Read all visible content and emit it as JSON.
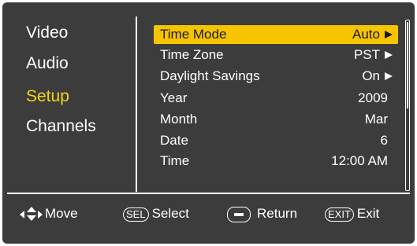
{
  "menu": {
    "items": [
      {
        "label": "Video",
        "active": false
      },
      {
        "label": "Audio",
        "active": false
      },
      {
        "label": "Setup",
        "active": true
      },
      {
        "label": "Channels",
        "active": false
      }
    ],
    "active_color": "#f6d31a"
  },
  "settings": {
    "rows": [
      {
        "label": "Time Mode",
        "value": "Auto",
        "has_arrow": true,
        "selected": true
      },
      {
        "label": "Time Zone",
        "value": "PST",
        "has_arrow": true,
        "selected": false
      },
      {
        "label": "Daylight Savings",
        "value": "On",
        "has_arrow": true,
        "selected": false
      },
      {
        "label": "Year",
        "value": "2009",
        "has_arrow": false,
        "selected": false
      },
      {
        "label": "Month",
        "value": "Mar",
        "has_arrow": false,
        "selected": false
      },
      {
        "label": "Date",
        "value": "6",
        "has_arrow": false,
        "selected": false
      },
      {
        "label": "Time",
        "value": "12:00 AM",
        "has_arrow": false,
        "selected": false
      }
    ],
    "highlight_color": "#f6c500"
  },
  "footer": {
    "move_label": "Move",
    "sel_badge": "SEL",
    "select_label": "Select",
    "return_label": "Return",
    "exit_badge": "EXIT",
    "exit_label": "Exit",
    "icons": [
      "dpad-icon",
      "sel-button-icon",
      "minus-button-icon",
      "exit-button-icon"
    ]
  }
}
